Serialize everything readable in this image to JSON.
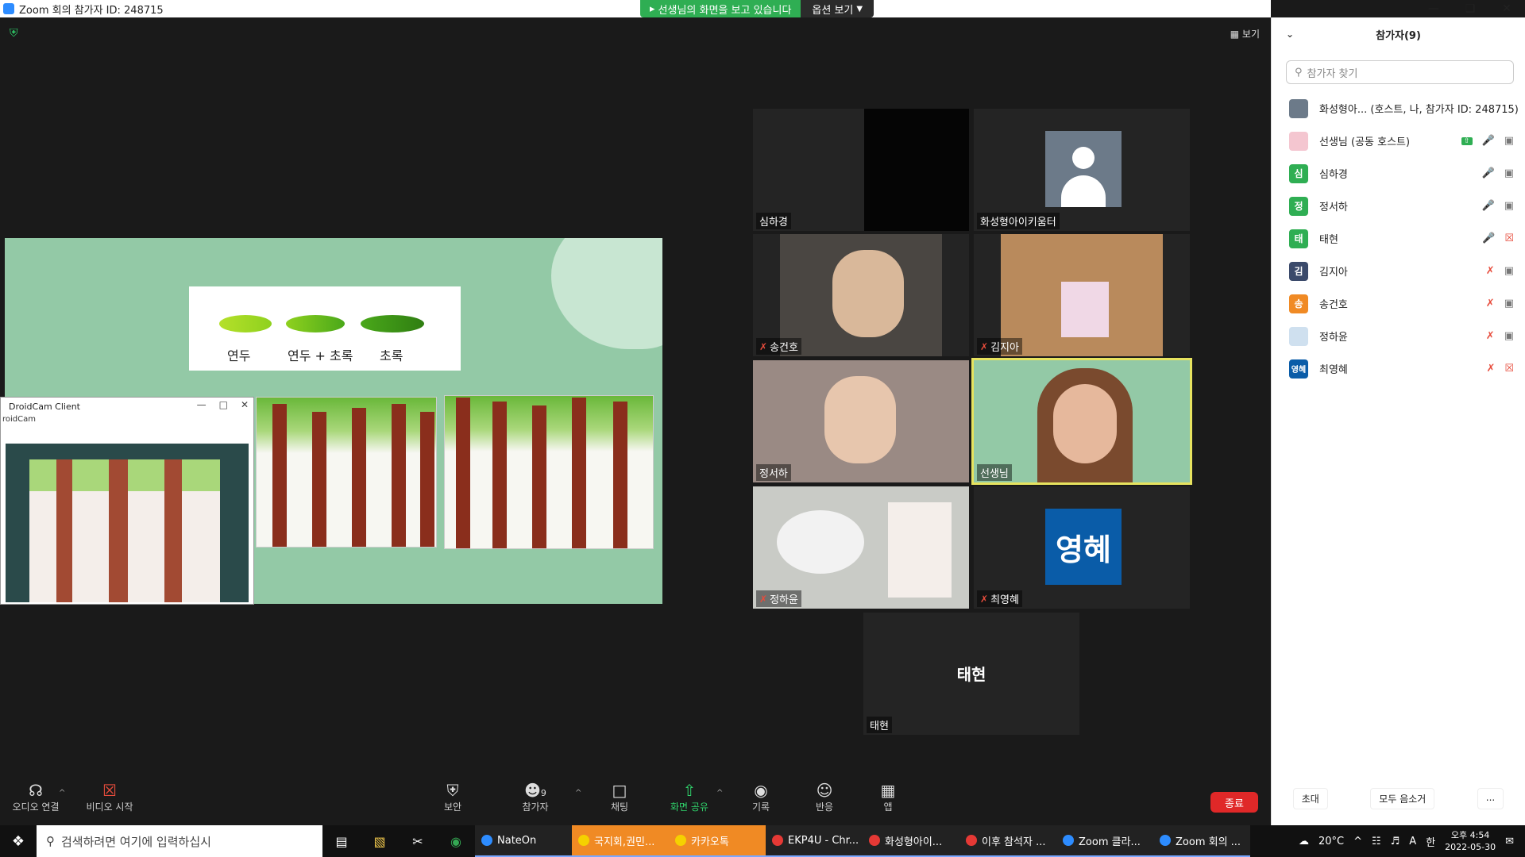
{
  "window": {
    "title": "Zoom 회의 참가자 ID: 248715"
  },
  "share_banner": {
    "status": "선생님의 화면을 보고 있습니다",
    "options": "옵션 보기"
  },
  "view": {
    "label": "보기"
  },
  "slide": {
    "swatch_labels": [
      "연두",
      "연두 + 초록",
      "초록"
    ],
    "colors": {
      "bg": "#93c9a6",
      "lime": "#8fd11e",
      "green": "#3f9a18"
    }
  },
  "droidcam": {
    "title": "DroidCam Client",
    "subtitle": "roidCam"
  },
  "gallery": [
    {
      "name": "심하경",
      "muted": false,
      "type": "video"
    },
    {
      "name": "화성형아이키움터",
      "muted": false,
      "type": "avatar"
    },
    {
      "name": "송건호",
      "muted": true,
      "type": "video"
    },
    {
      "name": "김지아",
      "muted": true,
      "type": "video"
    },
    {
      "name": "정서하",
      "muted": false,
      "type": "video"
    },
    {
      "name": "선생님",
      "muted": false,
      "type": "video",
      "active": true
    },
    {
      "name": "정하윤",
      "muted": true,
      "type": "video"
    },
    {
      "name": "최영혜",
      "muted": true,
      "type": "initials",
      "initials": "영혜"
    },
    {
      "name": "태현",
      "muted": false,
      "type": "name",
      "center_name": "태현"
    }
  ],
  "toolbar": {
    "audio": "오디오 연결",
    "video": "비디오 시작",
    "security": "보안",
    "participants": "참가자",
    "participants_count": "9",
    "chat": "채팅",
    "share": "화면 공유",
    "record": "기록",
    "reactions": "반응",
    "apps": "앱",
    "end": "종료"
  },
  "panel": {
    "title": "참가자(9)",
    "search_placeholder": "참가자 찾기",
    "participants": [
      {
        "initial": "",
        "name": "화성형아...  (호스트, 나, 참가자 ID: 248715)",
        "color": "#6c7a89"
      },
      {
        "initial": "",
        "name": "선생님 (공동 호스트)",
        "color": "#f4c6d0"
      },
      {
        "initial": "심",
        "name": "심하경",
        "color": "#2fae53"
      },
      {
        "initial": "정",
        "name": "정서하",
        "color": "#2fae53"
      },
      {
        "initial": "태",
        "name": "태현",
        "color": "#2fae53"
      },
      {
        "initial": "김",
        "name": "김지아",
        "color": "#3b4a6b"
      },
      {
        "initial": "송",
        "name": "송건호",
        "color": "#f08a24"
      },
      {
        "initial": "",
        "name": "정하윤",
        "color": "#cfe0ef"
      },
      {
        "initial": "영혜",
        "name": "최영혜",
        "color": "#0a5ca8"
      }
    ],
    "footer": {
      "invite": "초대",
      "mute_all": "모두 음소거",
      "more": "..."
    }
  },
  "taskbar": {
    "search_placeholder": "검색하려면 여기에 입력하십시",
    "apps": [
      {
        "label": "NateOn",
        "color": "#2d8cff"
      },
      {
        "label": "국지회,권민...",
        "color": "#f5d100",
        "highlight": true
      },
      {
        "label": "카카오톡",
        "color": "#f5d100",
        "highlight": true
      },
      {
        "label": "EKP4U - Chr...",
        "color": "#e53935"
      },
      {
        "label": "화성형아이...",
        "color": "#e53935"
      },
      {
        "label": "이후 참석자 ...",
        "color": "#e53935"
      },
      {
        "label": "Zoom 클라...",
        "color": "#2d8cff"
      },
      {
        "label": "Zoom 회의 ...",
        "color": "#2d8cff"
      }
    ],
    "weather": "20°C",
    "ime": "한",
    "ime_a": "A",
    "time": "오후 4:54",
    "date": "2022-05-30"
  }
}
